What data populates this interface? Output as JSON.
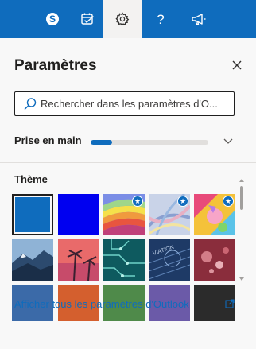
{
  "topbar": {
    "background": "#0f6cbd",
    "buttons": [
      {
        "name": "skype-icon",
        "active": false
      },
      {
        "name": "calendar-check-icon",
        "active": false
      },
      {
        "name": "gear-icon",
        "active": true
      },
      {
        "name": "help-icon",
        "active": false
      },
      {
        "name": "megaphone-icon",
        "active": false
      }
    ]
  },
  "panel": {
    "title": "Paramètres",
    "close_icon": "close-icon",
    "search": {
      "placeholder": "Rechercher dans les paramètres d'O...",
      "value": ""
    },
    "get_started": {
      "label": "Prise en main",
      "progress_percent": 18
    },
    "theme": {
      "label": "Thème",
      "tiles": [
        {
          "name": "theme-tile-blue-default",
          "selected": true,
          "star": false
        },
        {
          "name": "theme-tile-bright-blue",
          "selected": false,
          "star": false
        },
        {
          "name": "theme-tile-rainbow",
          "selected": false,
          "star": true
        },
        {
          "name": "theme-tile-abstract-lines",
          "selected": false,
          "star": true
        },
        {
          "name": "theme-tile-unicorn",
          "selected": false,
          "star": true
        },
        {
          "name": "theme-tile-mountains",
          "selected": false,
          "star": false
        },
        {
          "name": "theme-tile-palms",
          "selected": false,
          "star": false
        },
        {
          "name": "theme-tile-circuit",
          "selected": false,
          "star": false
        },
        {
          "name": "theme-tile-aviation",
          "selected": false,
          "star": false
        },
        {
          "name": "theme-tile-bokeh",
          "selected": false,
          "star": false
        }
      ]
    },
    "view_all_link": "Afficher tous les paramètres d'Outlook"
  }
}
